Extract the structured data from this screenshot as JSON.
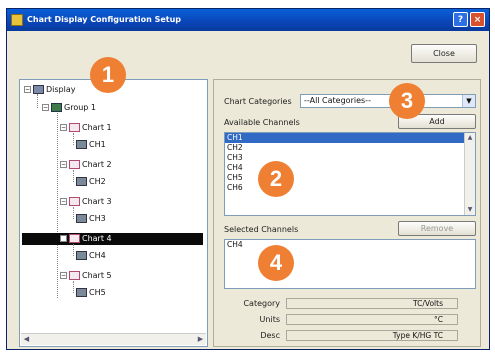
{
  "window": {
    "title": "Chart Display Configuration Setup",
    "help_label": "?",
    "close_label": "×"
  },
  "close_button": "Close",
  "tree": {
    "root": "Display",
    "group": "Group 1",
    "charts": [
      {
        "label": "Chart 1",
        "channel": "CH1",
        "selected": false
      },
      {
        "label": "Chart 2",
        "channel": "CH2",
        "selected": false
      },
      {
        "label": "Chart 3",
        "channel": "CH3",
        "selected": false
      },
      {
        "label": "Chart 4",
        "channel": "CH4",
        "selected": true
      },
      {
        "label": "Chart 5",
        "channel": "CH5",
        "selected": false
      }
    ],
    "expander_symbol": "−",
    "scroll_left": "◀",
    "scroll_right": "▶"
  },
  "config": {
    "chart_categories_label": "Chart Categories",
    "chart_categories_value": "--All Categories--",
    "available_channels_label": "Available Channels",
    "add_button": "Add",
    "available_channels": [
      "CH1",
      "CH2",
      "CH3",
      "CH4",
      "CH5",
      "CH6"
    ],
    "selected_available_index": 0,
    "selected_channels_label": "Selected Channels",
    "remove_button": "Remove",
    "selected_channels": [
      "CH4"
    ],
    "scroll_up": "▲",
    "scroll_down": "▼",
    "drop_arrow": "▼",
    "fields": [
      {
        "label": "Category",
        "value": "TC/Volts"
      },
      {
        "label": "Units",
        "value": "°C"
      },
      {
        "label": "Desc",
        "value": "Type K/HG TC"
      }
    ]
  },
  "badges": [
    "1",
    "2",
    "3",
    "4"
  ],
  "colors": {
    "badge": "#ef7f32",
    "title_bar": "#0a5fd8",
    "selection": "#316ac5",
    "tree_selection": "#0a0a0a"
  }
}
